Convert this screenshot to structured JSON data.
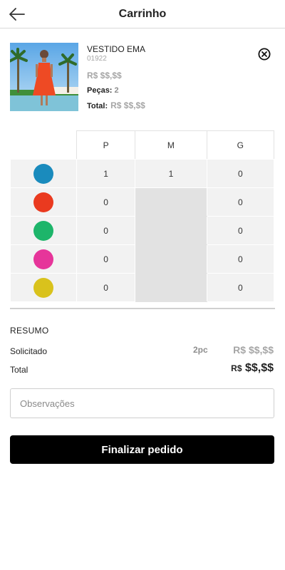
{
  "header": {
    "title": "Carrinho",
    "back_icon": "arrow-left-icon"
  },
  "product": {
    "name": "VESTIDO EMA",
    "code": "01922",
    "price": "R$ $$,$$",
    "pieces_label": "Peças:",
    "pieces_value": "2",
    "total_label": "Total:",
    "total_value": "R$ $$,$$",
    "remove_icon": "close-circle-icon"
  },
  "grid": {
    "sizes": [
      "P",
      "M",
      "G"
    ],
    "rows": [
      {
        "color": "#1a8bbd",
        "values": [
          "1",
          "1",
          "0"
        ]
      },
      {
        "color": "#ea3a1f",
        "values": [
          "0",
          null,
          "0"
        ]
      },
      {
        "color": "#1db56a",
        "values": [
          "0",
          null,
          "0"
        ]
      },
      {
        "color": "#e6359a",
        "values": [
          "0",
          null,
          "0"
        ]
      },
      {
        "color": "#d9c21c",
        "values": [
          "0",
          null,
          "0"
        ]
      }
    ]
  },
  "summary": {
    "title": "RESUMO",
    "requested_label": "Solicitado",
    "requested_qty": "2pc",
    "requested_value": "R$ $$,$$",
    "total_label": "Total",
    "total_currency": "R$",
    "total_value": "$$,$$"
  },
  "observations": {
    "placeholder": "Observações",
    "value": ""
  },
  "finish_button": {
    "label": "Finalizar pedido"
  }
}
